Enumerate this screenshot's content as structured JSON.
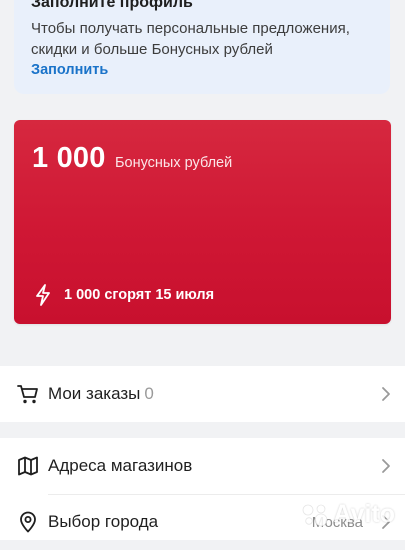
{
  "profile": {
    "title": "Заполните профиль",
    "description": "Чтобы получать персональные предложения, скидки и больше Бонусных рублей",
    "link": "Заполнить"
  },
  "bonus": {
    "amount": "1 000",
    "label": "Бонусных рублей",
    "expire": "1 000 сгорят 15 июля",
    "icon": "lightning-icon",
    "color": "#d21a36"
  },
  "menu": {
    "orders": {
      "label": "Мои заказы",
      "count": "0",
      "icon": "cart-icon"
    },
    "stores": {
      "label": "Адреса магазинов",
      "icon": "map-icon"
    },
    "city": {
      "label": "Выбор города",
      "value": "Москва",
      "icon": "location-pin-icon"
    }
  },
  "watermark": "Avito"
}
